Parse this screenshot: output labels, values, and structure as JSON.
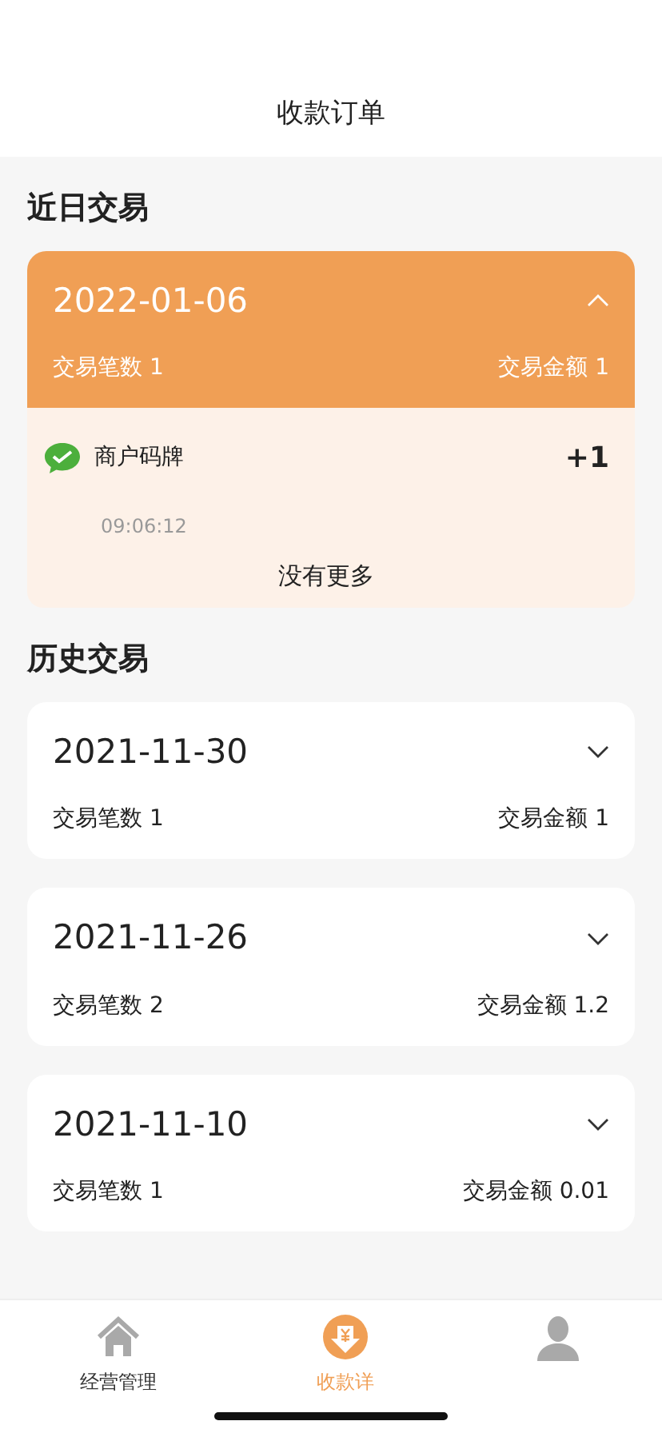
{
  "header": {
    "title": "收款订单"
  },
  "recent": {
    "heading": "近日交易",
    "days": [
      {
        "date": "2022-01-06",
        "expanded": true,
        "count_label": "交易笔数 1",
        "amount_label": "交易金额 1",
        "transactions": [
          {
            "name": "商户码牌",
            "amount": "+1",
            "time": "09:06:12"
          }
        ],
        "footer": "没有更多"
      }
    ]
  },
  "history": {
    "heading": "历史交易",
    "days": [
      {
        "date": "2021-11-30",
        "expanded": false,
        "count_label": "交易笔数 1",
        "amount_label": "交易金额 1"
      },
      {
        "date": "2021-11-26",
        "expanded": false,
        "count_label": "交易笔数 2",
        "amount_label": "交易金额 1.2"
      },
      {
        "date": "2021-11-10",
        "expanded": false,
        "count_label": "交易笔数 1",
        "amount_label": "交易金额 0.01"
      }
    ]
  },
  "tab_bar": [
    {
      "kind": "home",
      "label": "经营管理",
      "selected": false
    },
    {
      "kind": "receive",
      "label": "收款详",
      "selected": true
    },
    {
      "kind": "profile",
      "selected": false
    }
  ]
}
